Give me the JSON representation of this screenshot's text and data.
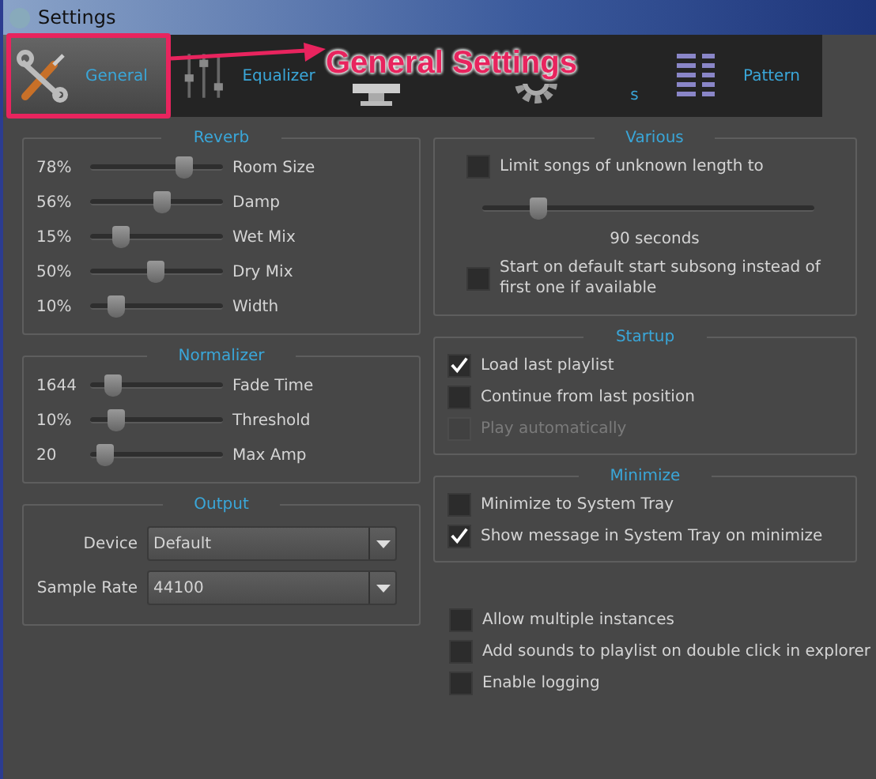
{
  "window": {
    "title": "Settings"
  },
  "tabs": [
    {
      "kind": "general",
      "label": "General",
      "selected": true
    },
    {
      "kind": "equalizer",
      "label": "Equalizer",
      "selected": false
    },
    {
      "kind": "monitor",
      "selected": false
    },
    {
      "kind": "gear",
      "label": "s",
      "selected": false
    },
    {
      "kind": "pattern",
      "label": "Pattern",
      "selected": false
    }
  ],
  "annotation": {
    "label": "General Settings"
  },
  "reverb": {
    "title": "Reverb",
    "sliders": [
      {
        "reading": "78%",
        "level": 0.75,
        "label": "Room Size"
      },
      {
        "reading": "56%",
        "level": 0.55,
        "label": "Damp"
      },
      {
        "reading": "15%",
        "level": 0.2,
        "label": "Wet Mix"
      },
      {
        "reading": "50%",
        "level": 0.5,
        "label": "Dry Mix"
      },
      {
        "reading": "10%",
        "level": 0.15,
        "label": "Width"
      }
    ]
  },
  "various": {
    "title": "Various",
    "items": [
      {
        "kind": "checkbox",
        "label": "Limit songs of unknown length to",
        "checked": false,
        "disabled": false
      },
      {
        "kind": "slider",
        "level": 0.15,
        "reading": "90 seconds"
      },
      {
        "kind": "checkbox",
        "label": "Start on default start subsong instead of first one if available",
        "checked": false,
        "disabled": false
      }
    ]
  },
  "normalizer": {
    "title": "Normalizer",
    "sliders": [
      {
        "reading": "1644",
        "level": 0.13,
        "label": "Fade Time"
      },
      {
        "reading": "10%",
        "level": 0.15,
        "label": "Threshold"
      },
      {
        "reading": "20",
        "level": 0.05,
        "label": "Max Amp"
      }
    ]
  },
  "startup": {
    "title": "Startup",
    "items": [
      {
        "label": "Load last playlist",
        "checked": true,
        "disabled": false
      },
      {
        "label": "Continue from last position",
        "checked": false,
        "disabled": false
      },
      {
        "label": "Play automatically",
        "checked": false,
        "disabled": true
      }
    ]
  },
  "output": {
    "title": "Output",
    "fields": [
      {
        "label": "Device",
        "value": "Default"
      },
      {
        "label": "Sample Rate",
        "value": "44100"
      }
    ]
  },
  "minimize": {
    "title": "Minimize",
    "items": [
      {
        "label": "Minimize to System Tray",
        "checked": false,
        "disabled": false
      },
      {
        "label": "Show message in System Tray on minimize",
        "checked": true,
        "disabled": false
      }
    ]
  },
  "misc": [
    {
      "label": "Allow multiple instances",
      "checked": false,
      "disabled": false
    },
    {
      "label": "Add sounds to playlist on double click in explorer",
      "checked": false,
      "disabled": false
    },
    {
      "label": "Enable logging",
      "checked": false,
      "disabled": false
    }
  ]
}
